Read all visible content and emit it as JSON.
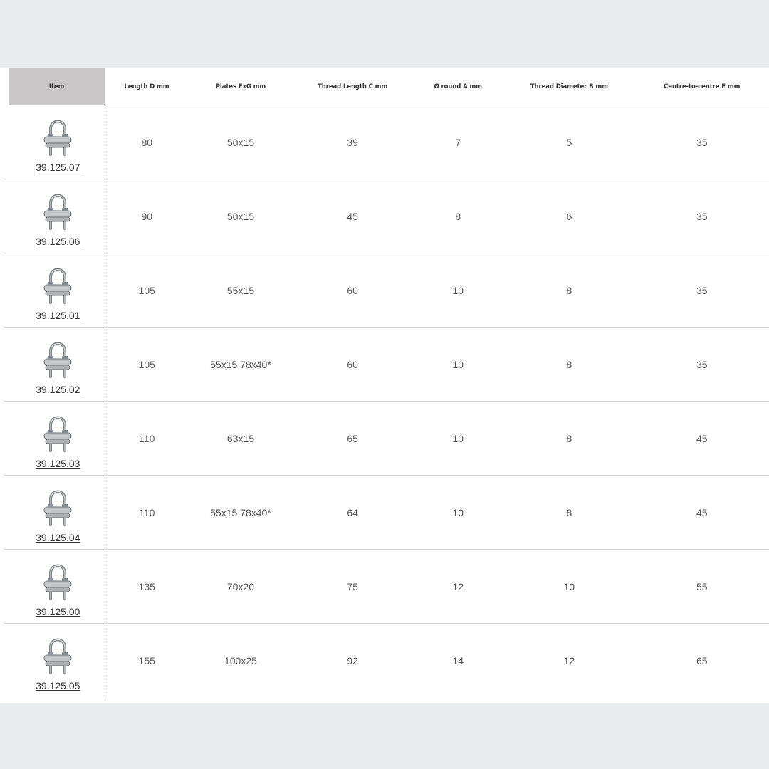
{
  "table": {
    "headers": [
      "Item",
      "Length D mm",
      "Plates FxG mm",
      "Thread Length C mm",
      "Ø round A mm",
      "Thread Diameter B mm",
      "Centre-to-centre E mm"
    ],
    "rows": [
      {
        "item": "39.125.07",
        "length": "80",
        "plates": "50x15",
        "thread_length": "39",
        "round": "7",
        "thread_diameter": "5",
        "centre": "35"
      },
      {
        "item": "39.125.06",
        "length": "90",
        "plates": "50x15",
        "thread_length": "45",
        "round": "8",
        "thread_diameter": "6",
        "centre": "35"
      },
      {
        "item": "39.125.01",
        "length": "105",
        "plates": "55x15",
        "thread_length": "60",
        "round": "10",
        "thread_diameter": "8",
        "centre": "35"
      },
      {
        "item": "39.125.02",
        "length": "105",
        "plates": "55x15 78x40*",
        "thread_length": "60",
        "round": "10",
        "thread_diameter": "8",
        "centre": "35"
      },
      {
        "item": "39.125.03",
        "length": "110",
        "plates": "63x15",
        "thread_length": "65",
        "round": "10",
        "thread_diameter": "8",
        "centre": "45"
      },
      {
        "item": "39.125.04",
        "length": "110",
        "plates": "55x15 78x40*",
        "thread_length": "64",
        "round": "10",
        "thread_diameter": "8",
        "centre": "45"
      },
      {
        "item": "39.125.00",
        "length": "135",
        "plates": "70x20",
        "thread_length": "75",
        "round": "12",
        "thread_diameter": "10",
        "centre": "55"
      },
      {
        "item": "39.125.05",
        "length": "155",
        "plates": "100x25",
        "thread_length": "92",
        "round": "14",
        "thread_diameter": "12",
        "centre": "65"
      }
    ],
    "row_icon": "u-bolt-product-icon"
  }
}
